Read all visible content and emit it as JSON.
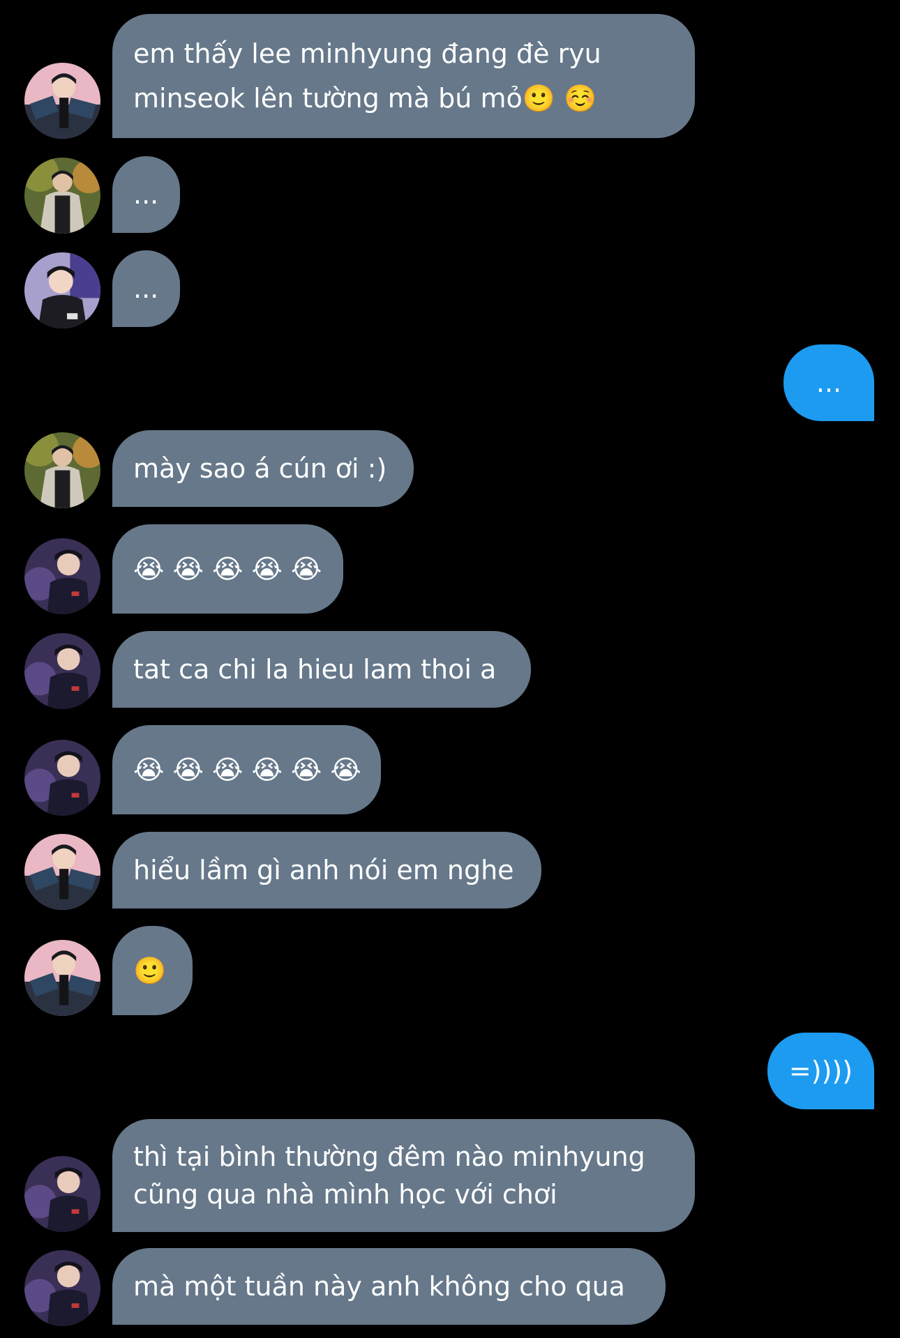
{
  "theme": {
    "background": "#000000",
    "incoming_bubble": "#66788a",
    "outgoing_bubble": "#1d9bf0",
    "text": "#ffffff"
  },
  "messages": [
    {
      "direction": "incoming",
      "avatar": "avatar-1",
      "lines": [
        "em thấy lee minhyung đang đè ryu",
        "minseok lên tường mà bú mỏ🙂 ☺️"
      ]
    },
    {
      "direction": "incoming",
      "avatar": "avatar-2",
      "lines": [
        "..."
      ]
    },
    {
      "direction": "incoming",
      "avatar": "avatar-3",
      "lines": [
        "..."
      ]
    },
    {
      "direction": "outgoing",
      "lines": [
        "..."
      ]
    },
    {
      "direction": "incoming",
      "avatar": "avatar-2",
      "lines": [
        "mày sao á cún ơi :)"
      ]
    },
    {
      "direction": "incoming",
      "avatar": "avatar-4",
      "lines": [
        "😭 😭 😭 😭 😭"
      ]
    },
    {
      "direction": "incoming",
      "avatar": "avatar-4",
      "lines": [
        "tat ca chi la hieu lam thoi a"
      ]
    },
    {
      "direction": "incoming",
      "avatar": "avatar-4",
      "lines": [
        "😭 😭 😭 😭 😭 😭"
      ]
    },
    {
      "direction": "incoming",
      "avatar": "avatar-1",
      "lines": [
        "hiểu lầm gì anh nói em nghe"
      ]
    },
    {
      "direction": "incoming",
      "avatar": "avatar-1",
      "lines": [
        "🙂"
      ]
    },
    {
      "direction": "outgoing",
      "lines": [
        "=))))"
      ]
    },
    {
      "direction": "incoming",
      "avatar": "avatar-4",
      "lines": [
        "thì tại bình thường đêm nào minhyung",
        "cũng qua nhà mình học với chơi"
      ]
    },
    {
      "direction": "incoming",
      "avatar": "avatar-4",
      "lines": [
        "mà một tuần này anh không cho qua"
      ]
    }
  ]
}
